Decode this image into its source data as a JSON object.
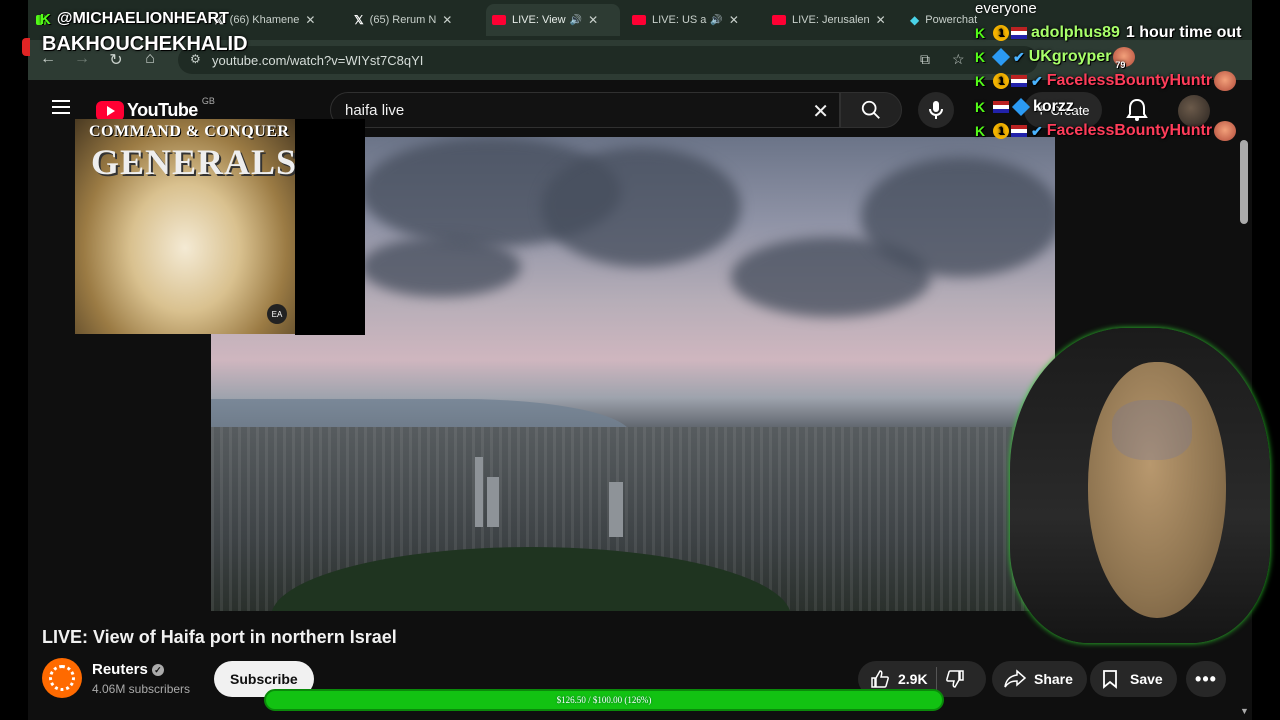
{
  "browser": {
    "tabs": [
      {
        "label": "",
        "type": "kick"
      },
      {
        "label": "(66) Khamene",
        "type": "x"
      },
      {
        "label": "(65) Rerum N",
        "type": "x"
      },
      {
        "label": "LIVE: View",
        "type": "yt",
        "active": true
      },
      {
        "label": "LIVE: US a",
        "type": "yt"
      },
      {
        "label": "LIVE: Jerusalen",
        "type": "yt"
      },
      {
        "label": "Powerchat",
        "type": "pc"
      }
    ],
    "url": "youtube.com/watch?v=WIYst7C8qYI"
  },
  "youtube": {
    "logo_text": "YouTube",
    "region": "GB",
    "search_query": "haifa live",
    "create_label": "Create",
    "video_title": "LIVE: View of Haifa port in northern Israel",
    "channel_name": "Reuters",
    "subscribers": "4.06M subscribers",
    "subscribe_label": "Subscribe",
    "likes": "2.9K",
    "share_label": "Share",
    "save_label": "Save"
  },
  "overlay": {
    "streamer_handle": "@MICHAELIONHEART",
    "viewer_name": "BAKHOUCHEKHALID",
    "chat_header": "everyone",
    "chat": [
      {
        "name": "adolphus89",
        "message": "1 hour time out",
        "color": "green",
        "badges": [
          "1",
          "flag"
        ]
      },
      {
        "name": "UKgroyper",
        "message": "",
        "color": "green",
        "badges": [
          "cube",
          "check"
        ],
        "emote": true,
        "emote_count": "79"
      },
      {
        "name": "FacelessBountyHuntr",
        "message": "",
        "color": "red",
        "badges": [
          "1",
          "flag",
          "check"
        ],
        "emote": true
      },
      {
        "name": "korzz",
        "message": "",
        "color": "white",
        "badges": [
          "flag",
          "cube"
        ]
      },
      {
        "name": "FacelessBountyHuntr",
        "message": "",
        "color": "red",
        "badges": [
          "1",
          "flag",
          "check"
        ],
        "emote": true
      }
    ],
    "cover_title_top": "COMMAND & CONQUER",
    "cover_title_main": "GENERALS",
    "cover_publisher": "EA",
    "donation_text": "$126.50 / $100.00 (126%)",
    "donation_progress": 1.265
  },
  "colors": {
    "kick_green": "#53fc18",
    "youtube_red": "#ff0033",
    "donation_green": "#12c212"
  }
}
